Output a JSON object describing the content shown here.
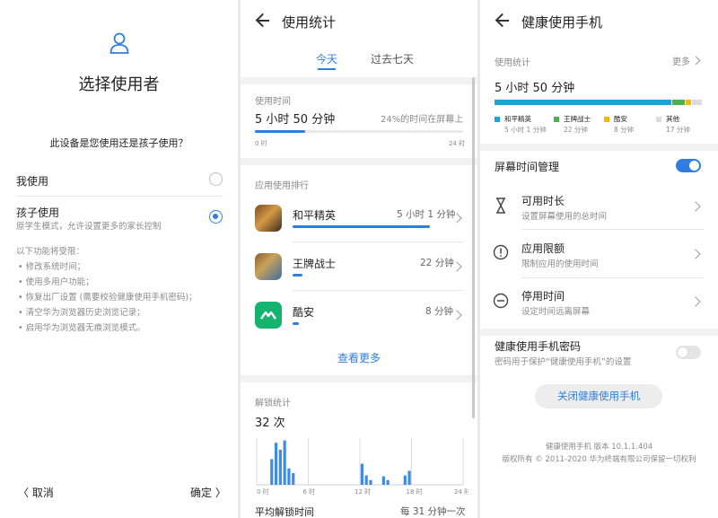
{
  "p1": {
    "title": "选择使用者",
    "question": "此设备是您使用还是孩子使用？",
    "option_me": "我使用",
    "option_child": "孩子使用",
    "option_child_desc": "原学生模式，允许设置更多的家长控制",
    "restrict_heading": "以下功能将受限：",
    "restrictions": [
      "•  修改系统时间；",
      "•  使用多用户功能；",
      "•  恢复出厂设置 (需要校验健康使用手机密码)；",
      "•  清空华为浏览器历史浏览记录；",
      "•  启用华为浏览器无痕浏览模式。"
    ],
    "cancel": "〈  取消",
    "confirm": "确定  〉"
  },
  "p2": {
    "title": "使用统计",
    "tab_today": "今天",
    "tab_week": "过去七天",
    "usage_label": "使用时间",
    "usage_value": "5 小时 50 分钟",
    "usage_pct": "24%的时间在屏幕上",
    "usage_fraction": 0.24,
    "axis_start": "0 时",
    "axis_end": "24 时",
    "ranking_label": "应用使用排行",
    "apps": [
      {
        "name": "和平精英",
        "time": "5 小时 1 分钟",
        "fraction": 0.86
      },
      {
        "name": "王牌战士",
        "time": "22 分钟",
        "fraction": 0.06
      },
      {
        "name": "酷安",
        "time": "8 分钟",
        "fraction": 0.025
      }
    ],
    "see_more": "查看更多",
    "unlock_label": "解锁统计",
    "unlock_value": "32 次",
    "unlock_ticks": [
      "0 时",
      "6 时",
      "12 时",
      "18 时",
      "24 时"
    ],
    "avg_label": "平均解锁时间",
    "avg_value": "每 31 分钟一次"
  },
  "chart_data": {
    "type": "bar",
    "title": "解锁统计",
    "x_ticks": [
      "0 时",
      "6 时",
      "12 时",
      "18 时",
      "24 时"
    ],
    "xlim": [
      0,
      24
    ],
    "values_by_half_hour": [
      0,
      0,
      0,
      0.55,
      0.9,
      0.75,
      0.95,
      0.35,
      0.25,
      0,
      0,
      0,
      0,
      0,
      0,
      0,
      0,
      0,
      0,
      0,
      0,
      0,
      0,
      0,
      0.45,
      0.2,
      0.1,
      0,
      0,
      0.18,
      0.1,
      0,
      0,
      0,
      0.2,
      0.3,
      0,
      0,
      0,
      0,
      0,
      0,
      0,
      0,
      0,
      0,
      0,
      0
    ]
  },
  "p3": {
    "title": "健康使用手机",
    "stats_label": "使用统计",
    "more": "更多",
    "total": "5 小时 50 分钟",
    "segments": [
      {
        "name": "和平精英",
        "time": "5 小时 1 分钟",
        "color": "#19a5d9",
        "fraction": 0.86
      },
      {
        "name": "王牌战士",
        "time": "22 分钟",
        "color": "#4caf50",
        "fraction": 0.063
      },
      {
        "name": "酷安",
        "time": "8 分钟",
        "color": "#f5b700",
        "fraction": 0.023
      },
      {
        "name": "其他",
        "time": "17 分钟",
        "color": "#dcdcdc",
        "fraction": 0.049
      }
    ],
    "screen_mgmt": "屏幕时间管理",
    "items": [
      {
        "title": "可用时长",
        "desc": "设置屏幕使用的总时间"
      },
      {
        "title": "应用限额",
        "desc": "限制应用的使用时间"
      },
      {
        "title": "停用时间",
        "desc": "设定时间远离屏幕"
      }
    ],
    "password_title": "健康使用手机密码",
    "password_desc": "密码用于保护“健康使用手机”的设置",
    "close_button": "关闭健康使用手机",
    "version": "健康使用手机 版本 10.1.1.404",
    "copyright": "版权所有 © 2011-2020 华为终端有限公司保留一切权利"
  }
}
